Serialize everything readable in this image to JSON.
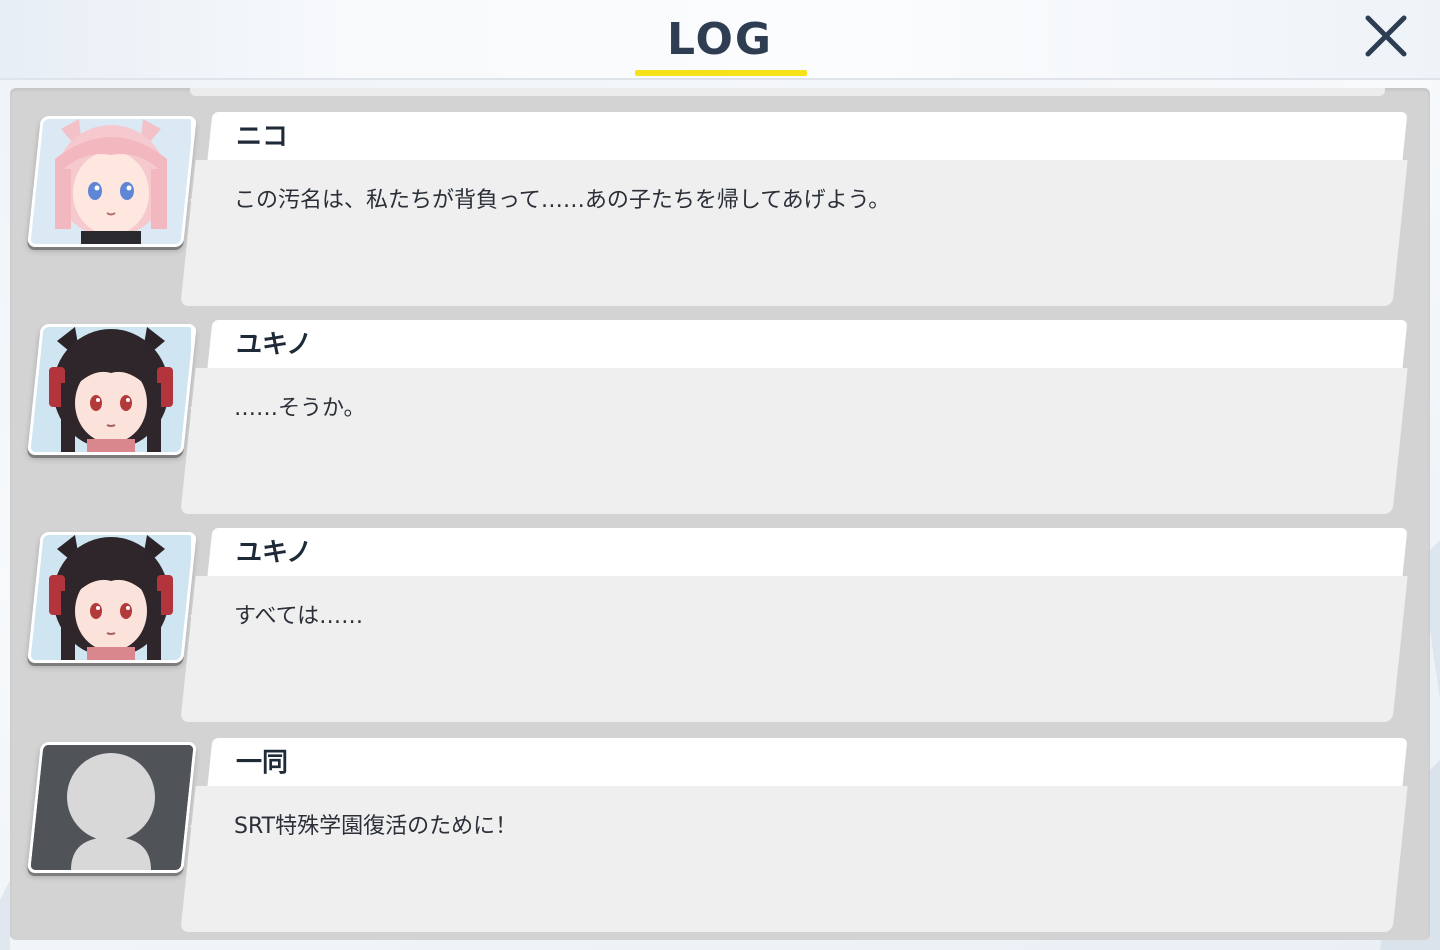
{
  "header": {
    "title": "LOG",
    "close_icon": "close-icon"
  },
  "colors": {
    "accent_underline": "#f5e21b",
    "title": "#2e3d52"
  },
  "entries": [
    {
      "speaker": "ニコ",
      "text": "この汚名は、私たちが背負って……あの子たちを帰してあげよう。",
      "avatar": "niko-portrait"
    },
    {
      "speaker": "ユキノ",
      "text": "……そうか。",
      "avatar": "yukino-portrait"
    },
    {
      "speaker": "ユキノ",
      "text": "すべては……",
      "avatar": "yukino-portrait"
    },
    {
      "speaker": "一同",
      "text": "SRT特殊学園復活のために！",
      "avatar": "silhouette-placeholder"
    }
  ]
}
